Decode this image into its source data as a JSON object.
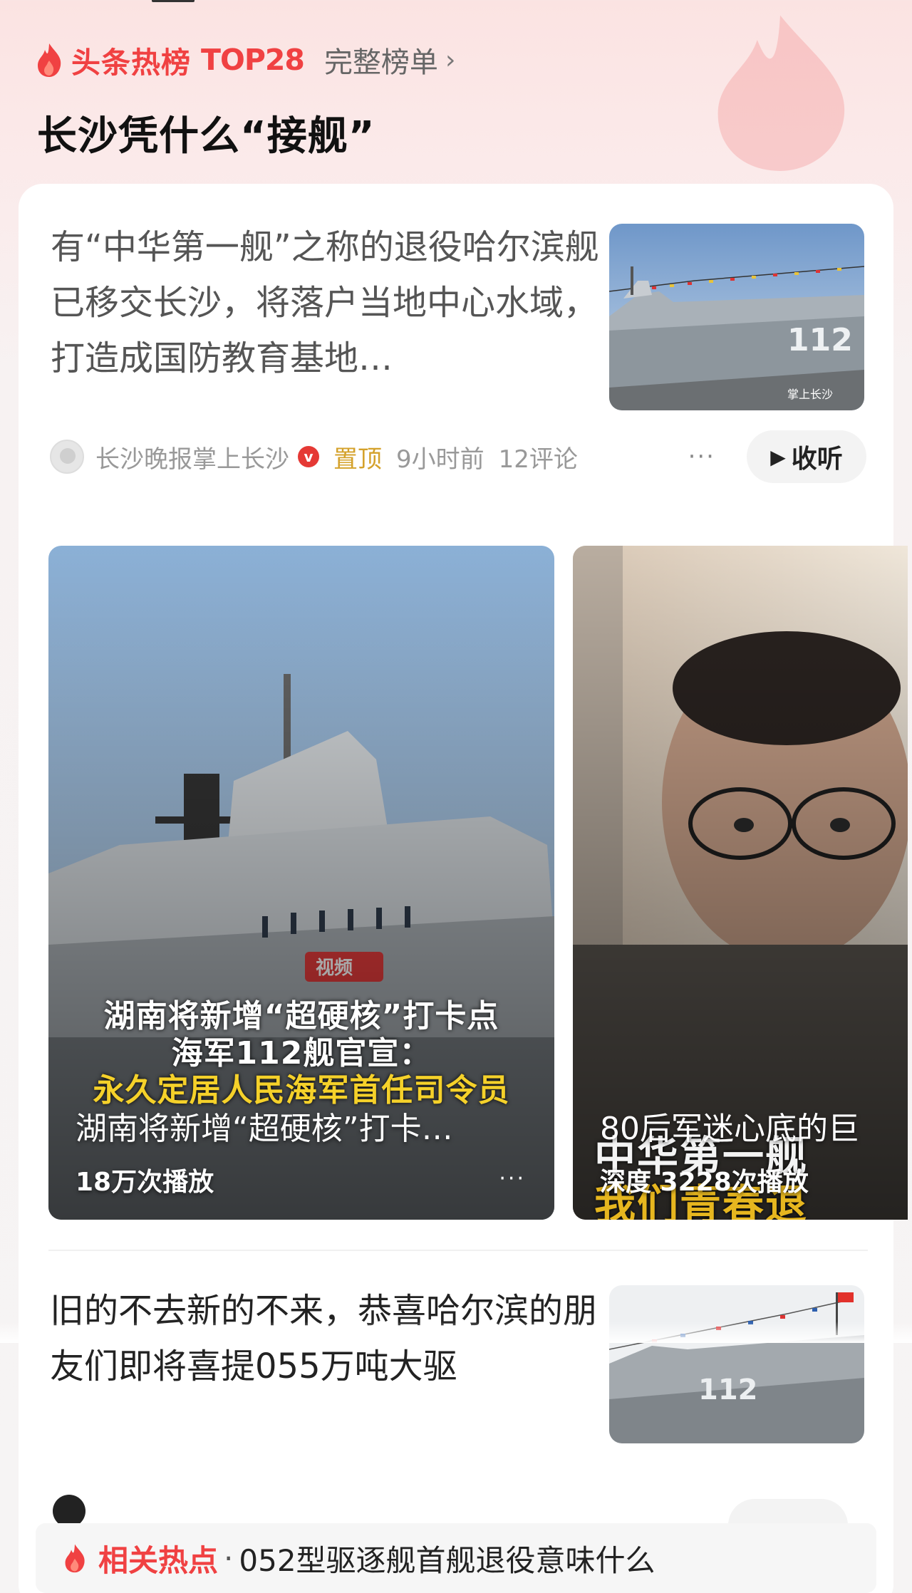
{
  "header": {
    "hot_list_label": "头条热榜",
    "rank": "TOP28",
    "full_list_label": "完整榜单",
    "topic_title": "长沙凭什么“接舰”"
  },
  "article1": {
    "text": "有“中华第一舰”之称的退役哈尔滨舰已移交长沙，将落户当地中心水域，打造成国防教育基地…",
    "thumb_ship_number": "112",
    "thumb_watermark": "掌上长沙",
    "source": "长沙晚报掌上长沙",
    "verified_badge": "v",
    "pin_label": "置顶",
    "time": "9小时前",
    "comments": "12评论",
    "more": "···",
    "listen_label": "收听"
  },
  "video1": {
    "title": "湖南将新增“超硬核”打卡…",
    "burned_line1": "湖南将新增“超硬核”打卡点",
    "burned_line2": "海军112舰官宣：",
    "burned_line3": "永久定居人民海军首任司令员",
    "logo_text": "视频",
    "views": "18万次播放",
    "more": "···"
  },
  "video2": {
    "title": "80后军迷心底的巨",
    "burned_top": "中华第一舰",
    "burned_bottom": "我们青春退",
    "views": "深度  3228次播放"
  },
  "article2": {
    "text": "旧的不去新的不来，恭喜哈尔滨的朋友们即将喜提055万吨大驱",
    "thumb_ship_number": "112"
  },
  "related": {
    "label": "相关热点",
    "separator": "·",
    "text": "052型驱逐舰首舰退役意味什么"
  },
  "colors": {
    "accent": "#f04142",
    "pin": "#d4a12a",
    "background_top": "#fbe3e2"
  },
  "icons": [
    "flame-icon",
    "chevron-right-icon",
    "verified-icon",
    "more-icon",
    "play-icon"
  ]
}
